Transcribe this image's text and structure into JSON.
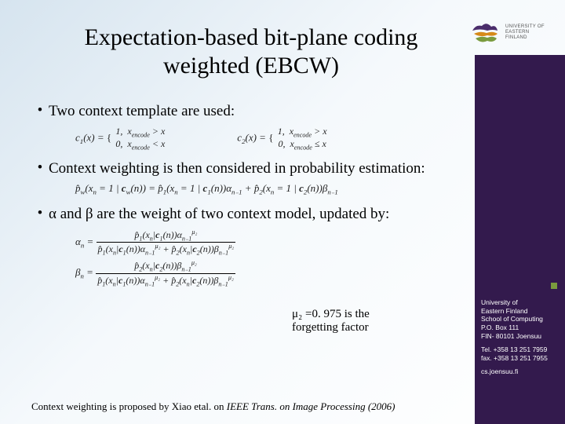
{
  "logo": {
    "line1": "UNIVERSITY OF",
    "line2": "EASTERN FINLAND"
  },
  "title": "Expectation-based bit-plane coding weighted (EBCW)",
  "bullets": {
    "b1": "Two context template are used:",
    "b2": "Context weighting is then considered in probability estimation:",
    "b3": "α and β are the weight of two context model, updated by:"
  },
  "eq": {
    "c1": "c₁(x) = { 1, x_encode > x ; 0, x_encode < x }",
    "c2": "c₂(x) = { 1, x_encode > x ; 0, x_encode ≤ x }",
    "pw": "p̂_w(xₙ = 1 | c_w(n)) = p̂₁(xₙ = 1 | c₁(n)) αₙ₋₁ + p̂₂(xₙ = 1 | c₂(n)) βₙ₋₁",
    "alpha_num": "p̂₁(xₙ | c₁(n)) αₙ₋₁^{μ₂}",
    "alpha_den": "p̂₁(xₙ | c₁(n)) αₙ₋₁^{μ₂} + p̂₂(xₙ | c₂(n)) βₙ₋₁^{μ₂}",
    "beta_num": "p̂₂(xₙ | c₂(n)) βₙ₋₁^{μ₂}",
    "beta_den": "p̂₁(xₙ | c₁(n)) αₙ₋₁^{μ₂} + p̂₂(xₙ | c₂(n)) βₙ₋₁^{μ₂}"
  },
  "note": "μ₂ =0. 975 is the forgetting factor",
  "footnote": {
    "pre": "Context weighting is proposed by Xiao etal. on ",
    "journal": "IEEE Trans. on Image Processing (2006)"
  },
  "sidebar": {
    "addr": "University of\nEastern Finland\nSchool of Computing\nP.O. Box 111\nFIN- 80101 Joensuu",
    "tel": "Tel. +358 13 251 7959\nfax. +358 13 251 7955",
    "url": "cs.joensuu.fi"
  }
}
